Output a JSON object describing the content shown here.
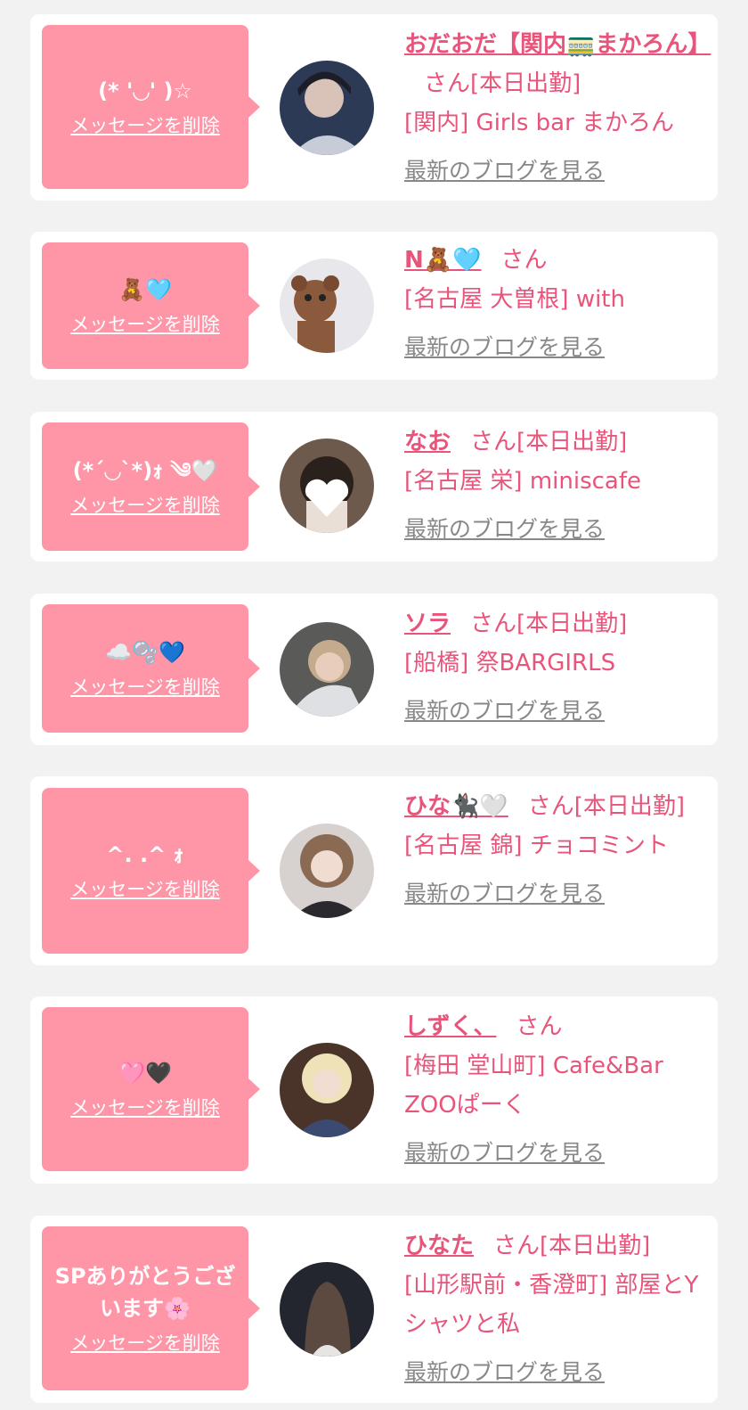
{
  "delete_label": "メッセージを削除",
  "blog_label": "最新のブログを見る",
  "entries": [
    {
      "message": "(* '◡' )☆",
      "name": "おだおだ【関内🚃まかろん】",
      "suffix": "さん[本日出勤]",
      "shop": "[関内] Girls bar まかろん"
    },
    {
      "message": "🧸🩵",
      "name": "N🧸🩵",
      "suffix": "さん",
      "shop": "[名古屋 大曽根] with"
    },
    {
      "message": "(*´◡`*)ｫ ༄🤍",
      "name": "なお",
      "suffix": "さん[本日出勤]",
      "shop": "[名古屋 栄] miniscafe"
    },
    {
      "message": "☁️🫧💙",
      "name": "ソラ",
      "suffix": "さん[本日出勤]",
      "shop": "[船橋] 祭BARGIRLS"
    },
    {
      "message": "^. .^ ｫ",
      "name": "ひな🐈‍⬛🤍",
      "suffix": "さん[本日出勤]",
      "shop": "[名古屋 錦] チョコミント"
    },
    {
      "message": "🩷🖤",
      "name": "しずく、",
      "suffix": "さん",
      "shop": "[梅田 堂山町] Cafe&Bar ZOOぱーく"
    },
    {
      "message": "SPありがとうございます🌸",
      "name": "ひなた",
      "suffix": "さん[本日出勤]",
      "shop": "[山形駅前・香澄町] 部屋とYシャツと私"
    }
  ],
  "colors": {
    "accent": "#e8547a",
    "bubble": "#ff96a8",
    "link_gray": "#888888",
    "background": "#f2f2f2"
  },
  "icons": [
    "avatar-photo"
  ]
}
